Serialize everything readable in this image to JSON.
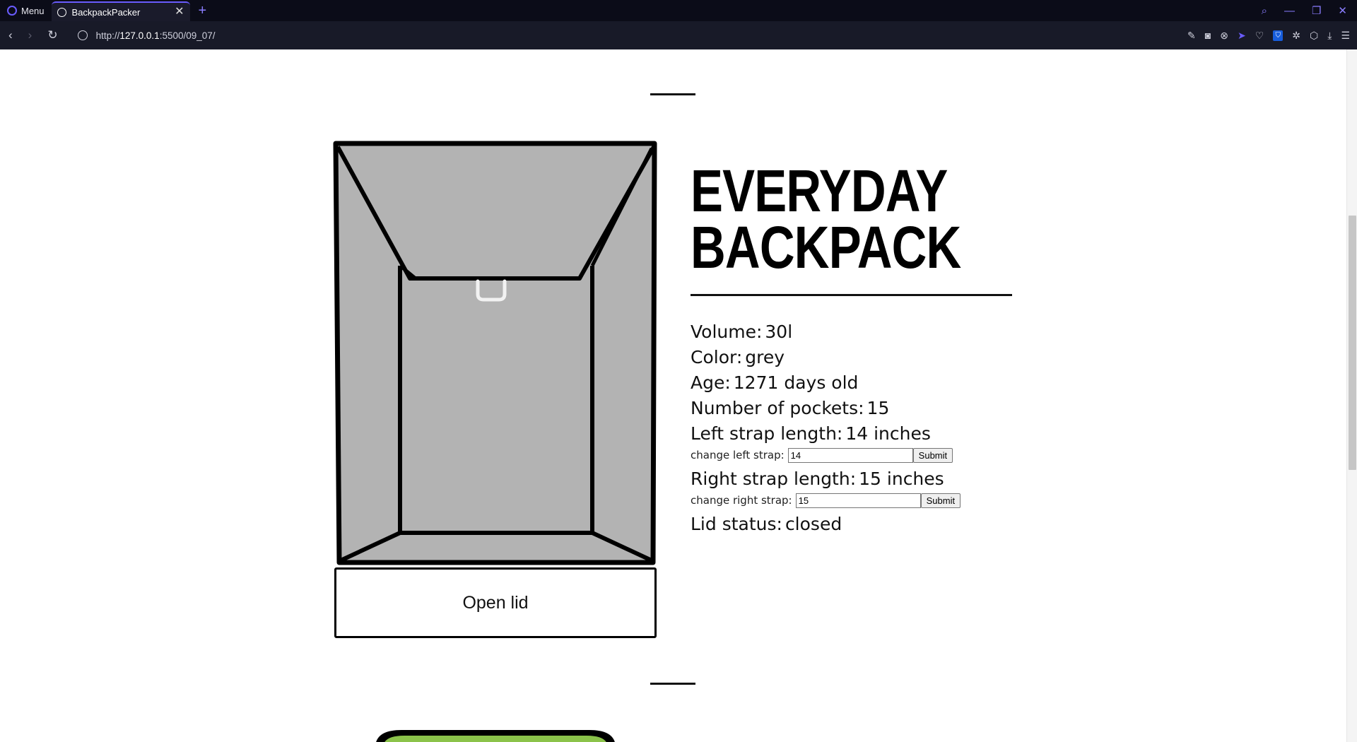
{
  "browser": {
    "menu_label": "Menu",
    "tab_title": "BackpackPacker",
    "url_prefix": "http://",
    "url_host": "127.0.0.1",
    "url_path": ":5500/09_07/"
  },
  "backpack": {
    "name": "Everyday Backpack",
    "properties": [
      {
        "label": "Volume:",
        "value": "30l"
      },
      {
        "label": "Color:",
        "value": "grey"
      },
      {
        "label": "Age:",
        "value": "1271 days old"
      },
      {
        "label": "Number of pockets:",
        "value": "15"
      },
      {
        "label": "Left strap length:",
        "value": "14 inches"
      },
      {
        "label": "Right strap length:",
        "value": "15 inches"
      },
      {
        "label": "Lid status:",
        "value": "closed"
      }
    ],
    "left_strap_form": {
      "label": "change left strap:",
      "value": "14",
      "submit": "Submit"
    },
    "right_strap_form": {
      "label": "change right strap:",
      "value": "15",
      "submit": "Submit"
    },
    "lid_button": "Open lid",
    "body_color": "#b3b3b3",
    "next_backpack_color": "#8bc34a"
  }
}
